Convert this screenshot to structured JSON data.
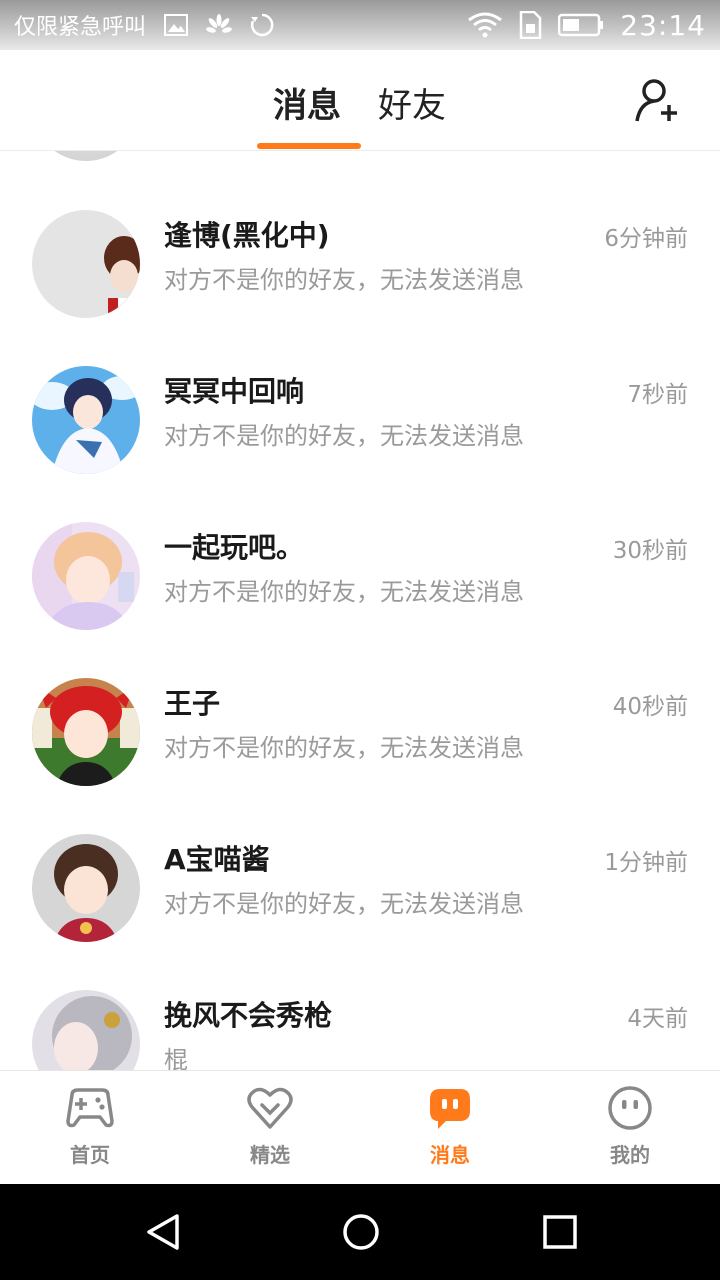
{
  "status_bar": {
    "carrier_text": "仅限紧急呼叫",
    "time": "23:14",
    "icons": [
      "image-icon",
      "huawei-icon",
      "sync-icon",
      "wifi-icon",
      "sim-icon",
      "battery-icon"
    ]
  },
  "header": {
    "tabs": [
      {
        "label": "消息",
        "active": true
      },
      {
        "label": "好友",
        "active": false
      }
    ],
    "accent_color": "#ff7a1a",
    "add_friend_icon": "add-user-icon"
  },
  "messages": [
    {
      "name": "逢博(黑化中)",
      "preview": "对方不是你的好友，无法发送消息",
      "time": "6分钟前"
    },
    {
      "name": "冥冥中回响",
      "preview": "对方不是你的好友，无法发送消息",
      "time": "7秒前"
    },
    {
      "name": "一起玩吧。",
      "preview": "对方不是你的好友，无法发送消息",
      "time": "30秒前"
    },
    {
      "name": "王子",
      "preview": "对方不是你的好友，无法发送消息",
      "time": "40秒前"
    },
    {
      "name": "A宝喵酱",
      "preview": "对方不是你的好友，无法发送消息",
      "time": "1分钟前"
    },
    {
      "name": "挽风不会秀枪",
      "preview": "棍",
      "time": "4天前"
    }
  ],
  "bottom_nav": [
    {
      "label": "首页",
      "icon": "gamepad-icon",
      "active": false
    },
    {
      "label": "精选",
      "icon": "heart-icon",
      "active": false
    },
    {
      "label": "消息",
      "icon": "chat-icon",
      "active": true
    },
    {
      "label": "我的",
      "icon": "smiley-icon",
      "active": false
    }
  ],
  "system_nav": [
    "back-icon",
    "home-icon",
    "recents-icon"
  ]
}
